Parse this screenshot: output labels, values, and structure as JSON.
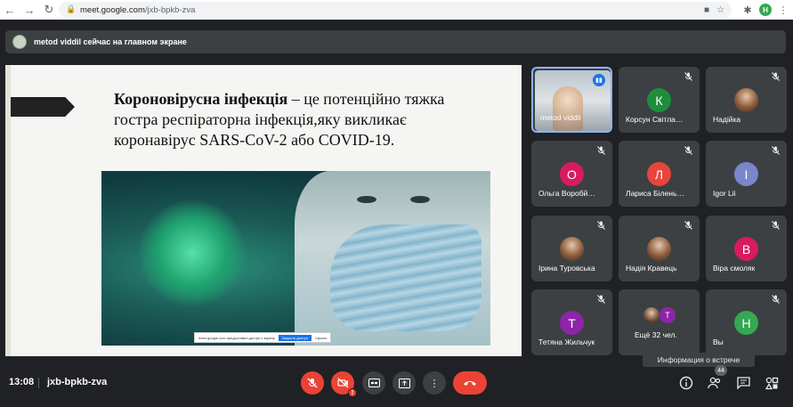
{
  "browser": {
    "url_host": "meet.google.com",
    "url_path": "/jxb-bpkb-zva",
    "profile_initial": "H"
  },
  "banner": {
    "text": "metod viddil сейчас на главном экране"
  },
  "slide": {
    "title_bold": "Короновірусна інфекція",
    "body": " – це потенційно тяжка гостра респіраторна інфекція,яку викликає коронавірус SARS-CoV-2 або COVID-19.",
    "toolbar_text": "meet.google.com предоставил доступ к экрану",
    "toolbar_button": "Закрыть доступ",
    "toolbar_hide": "Скрыть"
  },
  "participants": [
    {
      "name": "metod viddil",
      "initial": "",
      "color": "",
      "video": true,
      "speaking": true
    },
    {
      "name": "Корсун Світла…",
      "initial": "К",
      "color": "#1e8e3e",
      "video": false
    },
    {
      "name": "Надійка",
      "initial": "",
      "color": "",
      "photo": true
    },
    {
      "name": "Ольга Воробй…",
      "initial": "О",
      "color": "#d81b60",
      "video": false
    },
    {
      "name": "Лариса Білень…",
      "initial": "Л",
      "color": "#e8453c",
      "video": false
    },
    {
      "name": "Igor Lii",
      "initial": "I",
      "color": "#7986cb",
      "video": false
    },
    {
      "name": "Ірина Туровська",
      "initial": "",
      "color": "",
      "photo": true
    },
    {
      "name": "Надія Кравець",
      "initial": "",
      "color": "",
      "photo": true
    },
    {
      "name": "Віра смоляк",
      "initial": "В",
      "color": "#d81b60",
      "video": false
    },
    {
      "name": "Тетяна Жильчук",
      "initial": "Т",
      "color": "#8e24aa",
      "video": false
    },
    {
      "name": "Ещё 32 чел.",
      "initial": "Т",
      "color": "#8e24aa",
      "more": true
    },
    {
      "name": "Вы",
      "initial": "Н",
      "color": "#34a853",
      "video": false
    }
  ],
  "tooltip": "Информация о встрече",
  "bottom": {
    "time": "13:08",
    "meeting_code": "jxb-bpkb-zva",
    "participant_count": "44"
  }
}
